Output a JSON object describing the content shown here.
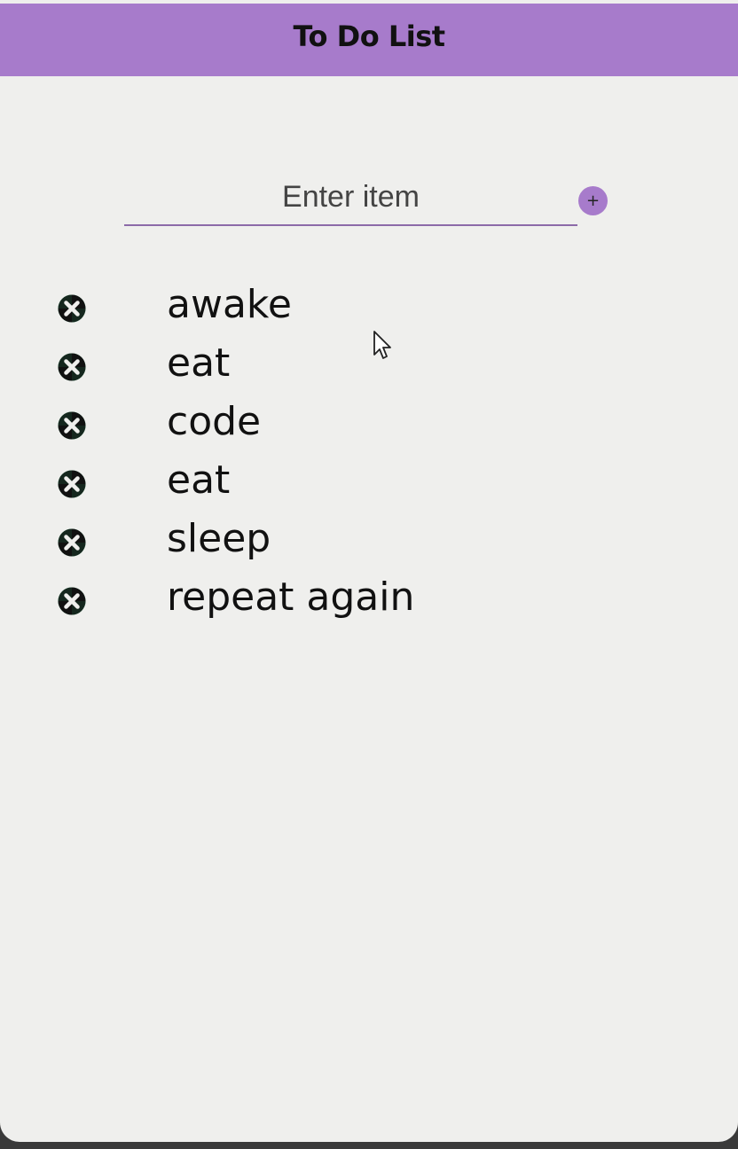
{
  "header": {
    "title": "To Do List"
  },
  "input": {
    "placeholder": "Enter item",
    "value": ""
  },
  "add_button": {
    "label": "+",
    "icon": "plus-icon"
  },
  "items": [
    {
      "text": "awake",
      "delete_icon": "x-circle-icon"
    },
    {
      "text": "eat",
      "delete_icon": "x-circle-icon"
    },
    {
      "text": "code",
      "delete_icon": "x-circle-icon"
    },
    {
      "text": "eat",
      "delete_icon": "x-circle-icon"
    },
    {
      "text": "sleep",
      "delete_icon": "x-circle-icon"
    },
    {
      "text": "repeat again",
      "delete_icon": "x-circle-icon"
    }
  ],
  "colors": {
    "accent": "#a77bcb",
    "underline": "#8c6aa8",
    "delete_icon_fill": "#111111",
    "delete_icon_accent": "#2fa86a",
    "background": "#efefed"
  }
}
